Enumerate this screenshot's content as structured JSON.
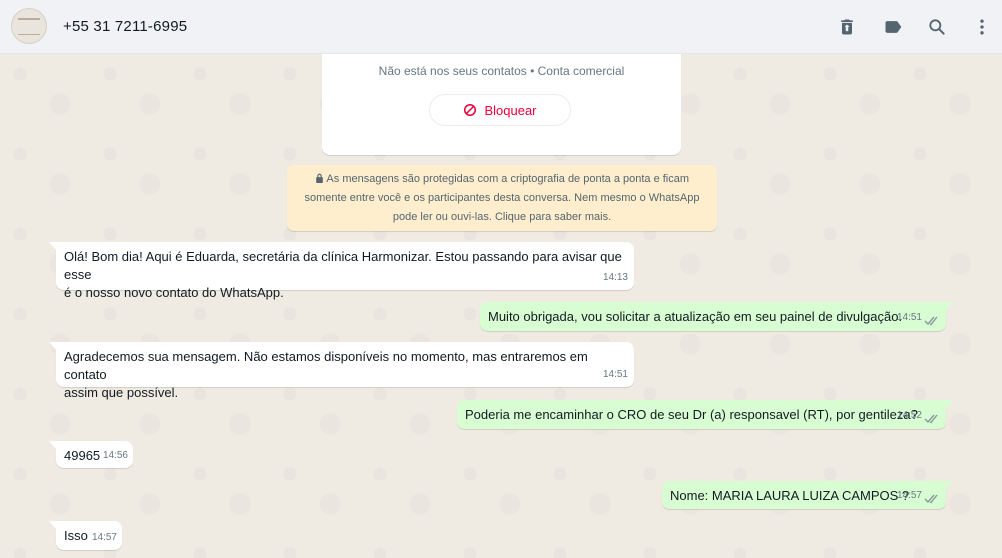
{
  "header": {
    "contact_name": "+55 31 7211-6995",
    "icons": [
      "delete-icon",
      "label-icon",
      "search-icon",
      "menu-icon"
    ]
  },
  "info_card": {
    "status_text": "Não está nos seus contatos • Conta comercial",
    "block_label": "Bloquear"
  },
  "encryption_notice": {
    "line1": "As mensagens são protegidas com a criptografia de ponta a ponta e ficam",
    "line2": "somente entre você e os participantes desta conversa. Nem mesmo o WhatsApp",
    "line3": "pode ler ou ouvi-las. Clique para saber mais."
  },
  "messages": [
    {
      "direction": "incoming",
      "text": "Olá! Bom dia! Aqui é Eduarda, secretária da clínica Harmonizar. Estou passando para avisar que esse\né o nosso novo contato do WhatsApp.",
      "time": "14:13"
    },
    {
      "direction": "outgoing",
      "text": "Muito obrigada, vou solicitar a atualização em seu painel de divulgação.",
      "time": "14:51",
      "status": "read"
    },
    {
      "direction": "incoming",
      "text": "Agradecemos sua mensagem. Não estamos disponíveis no momento, mas entraremos em contato\nassim que possível.",
      "time": "14:51"
    },
    {
      "direction": "outgoing",
      "text": "Poderia me encaminhar o CRO de seu Dr (a) responsavel (RT), por gentileza?",
      "time": "14:52",
      "status": "read"
    },
    {
      "direction": "incoming",
      "text": "49965",
      "time": "14:56"
    },
    {
      "direction": "outgoing",
      "text": "Nome: MARIA LAURA LUIZA CAMPOS ?",
      "time": "14:57",
      "status": "read"
    },
    {
      "direction": "incoming",
      "text": "Isso",
      "time": "14:57"
    }
  ],
  "colors": {
    "header_bg": "#f0f2f5",
    "chat_bg": "#efeae2",
    "incoming_bubble": "#ffffff",
    "outgoing_bubble": "#d9fdd3",
    "block_red": "#ea0038",
    "notice_bg": "#ffeecd",
    "read_ticks": "#8696a0"
  }
}
